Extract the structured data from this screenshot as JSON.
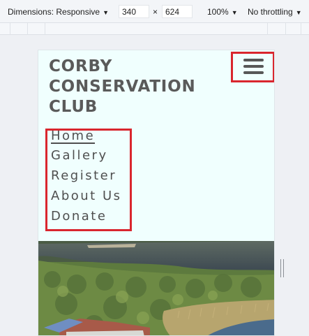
{
  "devtools": {
    "dimensions_label": "Dimensions: Responsive",
    "width_value": "340",
    "times_sign": "×",
    "height_value": "624",
    "zoom": "100%",
    "throttling": "No throttling"
  },
  "site": {
    "title_lines": [
      "CORBY",
      "CONSERVATION",
      "CLUB"
    ],
    "nav": [
      {
        "label": "Home",
        "active": true
      },
      {
        "label": "Gallery",
        "active": false
      },
      {
        "label": "Register",
        "active": false
      },
      {
        "label": "About Us",
        "active": false
      },
      {
        "label": "Donate",
        "active": false
      }
    ]
  },
  "colors": {
    "page_background": "#f0fffe",
    "highlight_red": "#d9262e",
    "text_gray": "#5a5a5a"
  },
  "icons": {
    "menu": "hamburger-icon",
    "dropdown": "caret-down-icon"
  }
}
